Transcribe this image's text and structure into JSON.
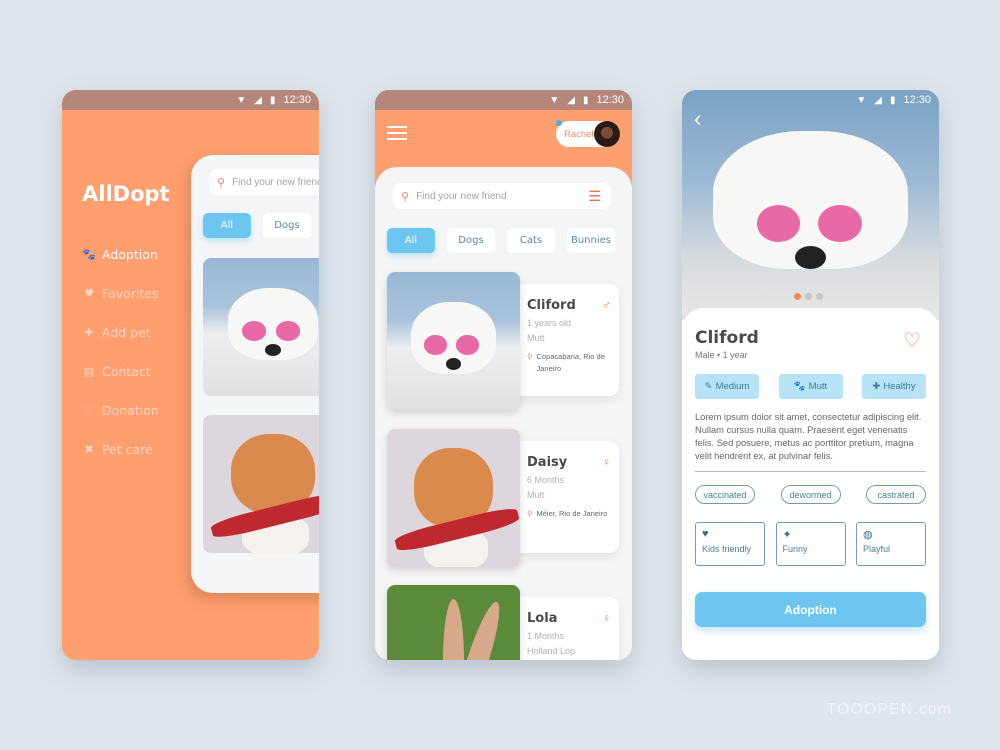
{
  "status_bar": {
    "time": "12:30"
  },
  "drawer_screen": {
    "logo": "AllDopt",
    "menu": [
      {
        "label": "Adoption",
        "icon": "paw-icon",
        "glyph": "🐾",
        "active": true
      },
      {
        "label": "Favorites",
        "icon": "heart-icon",
        "glyph": "♥",
        "active": false
      },
      {
        "label": "Add pet",
        "icon": "plus-icon",
        "glyph": "✚",
        "active": false
      },
      {
        "label": "Contact",
        "icon": "chat-icon",
        "glyph": "▤",
        "active": false
      },
      {
        "label": "Donation",
        "icon": "donation-icon",
        "glyph": "♡",
        "active": false
      },
      {
        "label": "Pet care",
        "icon": "bandage-icon",
        "glyph": "✖",
        "active": false
      }
    ],
    "search_placeholder": "Find your new friend",
    "chips": [
      "All",
      "Dogs"
    ]
  },
  "list_screen": {
    "user_name": "Rachel",
    "search_placeholder": "Find your new friend",
    "chips": [
      "All",
      "Dogs",
      "Cats",
      "Bunnies"
    ],
    "pets": [
      {
        "name": "Cliford",
        "age": "1 years old",
        "breed": "Mutt",
        "location": "Copacabana, Rio de Janeiro",
        "sex": "♂"
      },
      {
        "name": "Daisy",
        "age": "6 Months",
        "breed": "Mutt",
        "location": "Méier, Rio de Janeiro",
        "sex": "♀"
      },
      {
        "name": "Lola",
        "age": "1 Months",
        "breed": "Holland Lop",
        "location": "",
        "sex": "♀"
      }
    ]
  },
  "detail_screen": {
    "name": "Cliford",
    "subtitle": "Male • 1 year",
    "attributes": [
      {
        "label": "Medium",
        "glyph": "✎"
      },
      {
        "label": "Mutt",
        "glyph": "🐾"
      },
      {
        "label": "Healthy",
        "glyph": "✚"
      }
    ],
    "description": "Lorem ipsum dolor sit amet, consectetur adipiscing elit. Nullam cursus nulla quam. Praesent eget venenatis felis. Sed posuere, metus ac porttitor pretium, magna velit hendrerit ex, at pulvinar felis.",
    "tags": [
      "vaccinated",
      "dewormed",
      "castrated"
    ],
    "traits": [
      {
        "label": "Kids friendly",
        "glyph": "♥"
      },
      {
        "label": "Funny",
        "glyph": "✦"
      },
      {
        "label": "Playful",
        "glyph": "◍"
      }
    ],
    "button": "Adoption",
    "carousel_index": 1,
    "carousel_count": 3
  },
  "watermark": "TOOOPEN.com",
  "colors": {
    "brand_orange": "#ff9f6f",
    "accent_blue": "#6cc6ef",
    "status_bar": "#b5877a"
  }
}
